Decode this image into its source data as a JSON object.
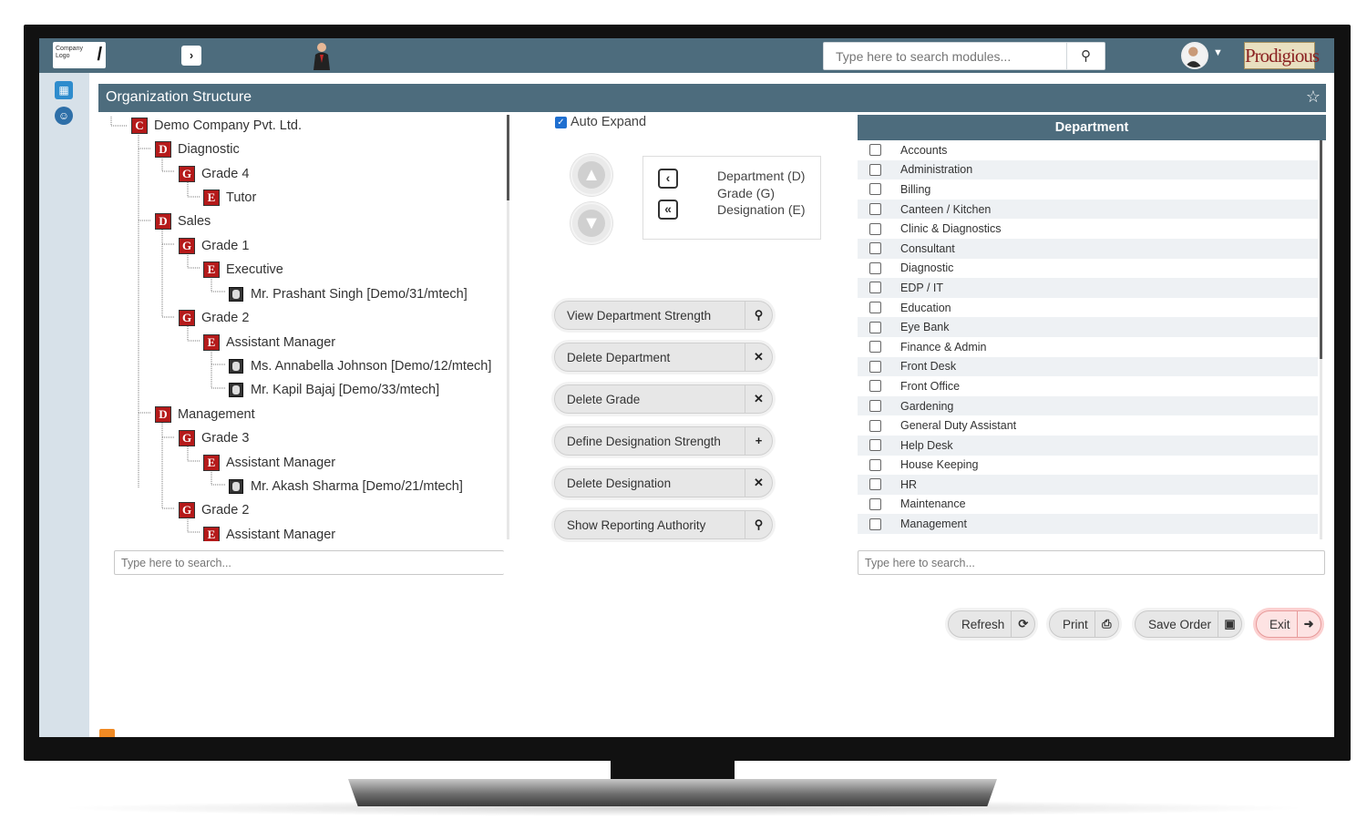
{
  "header": {
    "logo_text": "Company Logo",
    "search": {
      "placeholder": "Type here to search modules..."
    },
    "brand": "Prodigious",
    "icons": {
      "nav": "circle-arrow-icon",
      "search": "search-icon",
      "user": "user-avatar-icon",
      "caret": "caret-down-icon"
    }
  },
  "panel": {
    "title": "Organization Structure",
    "favorite_icon": "star-icon"
  },
  "tree": {
    "nodes": [
      {
        "badge": "C",
        "label": "Demo Company Pvt. Ltd."
      },
      {
        "badge": "D",
        "label": "Diagnostic"
      },
      {
        "badge": "G",
        "label": "Grade 4"
      },
      {
        "badge": "E",
        "label": "Tutor"
      },
      {
        "badge": "D",
        "label": "Sales"
      },
      {
        "badge": "G",
        "label": "Grade 1"
      },
      {
        "badge": "E",
        "label": "Executive"
      },
      {
        "badge": "",
        "label": "Mr. Prashant Singh [Demo/31/mtech]"
      },
      {
        "badge": "G",
        "label": "Grade 2"
      },
      {
        "badge": "E",
        "label": "Assistant Manager"
      },
      {
        "badge": "",
        "label": "Ms. Annabella Johnson [Demo/12/mtech]"
      },
      {
        "badge": "",
        "label": "Mr. Kapil Bajaj [Demo/33/mtech]"
      },
      {
        "badge": "D",
        "label": "Management"
      },
      {
        "badge": "G",
        "label": "Grade 3"
      },
      {
        "badge": "E",
        "label": "Assistant Manager"
      },
      {
        "badge": "",
        "label": "Mr. Akash Sharma [Demo/21/mtech]"
      },
      {
        "badge": "G",
        "label": "Grade 2"
      },
      {
        "badge": "E",
        "label": "Assistant Manager"
      }
    ],
    "search": {
      "placeholder": "Type here to search..."
    }
  },
  "controls": {
    "auto_expand": "Auto Expand",
    "legend": {
      "department": "Department (D)",
      "grade": "Grade (G)",
      "designation": "Designation (E)",
      "single_icon": "‹",
      "double_icon": "«"
    },
    "actions": [
      {
        "label": "View Department Strength",
        "icon": "search-icon",
        "glyph": "⚲"
      },
      {
        "label": "Delete Department",
        "icon": "close-icon",
        "glyph": "✕"
      },
      {
        "label": "Delete Grade",
        "icon": "close-icon",
        "glyph": "✕"
      },
      {
        "label": "Define Designation Strength",
        "icon": "plus-icon",
        "glyph": "+"
      },
      {
        "label": "Delete Designation",
        "icon": "close-icon",
        "glyph": "✕"
      },
      {
        "label": "Show Reporting Authority",
        "icon": "search-icon",
        "glyph": "⚲"
      }
    ]
  },
  "department": {
    "header": "Department",
    "items": [
      "Accounts",
      "Administration",
      "Billing",
      "Canteen / Kitchen",
      "Clinic & Diagnostics",
      "Consultant",
      "Diagnostic",
      "EDP / IT",
      "Education",
      "Eye Bank",
      "Finance & Admin",
      "Front Desk",
      "Front Office",
      "Gardening",
      "General Duty Assistant",
      "Help Desk",
      "House Keeping",
      "HR",
      "Maintenance",
      "Management"
    ],
    "search": {
      "placeholder": "Type here to search..."
    }
  },
  "footer": {
    "refresh": "Refresh",
    "print": "Print",
    "save_order": "Save Order",
    "exit": "Exit"
  }
}
